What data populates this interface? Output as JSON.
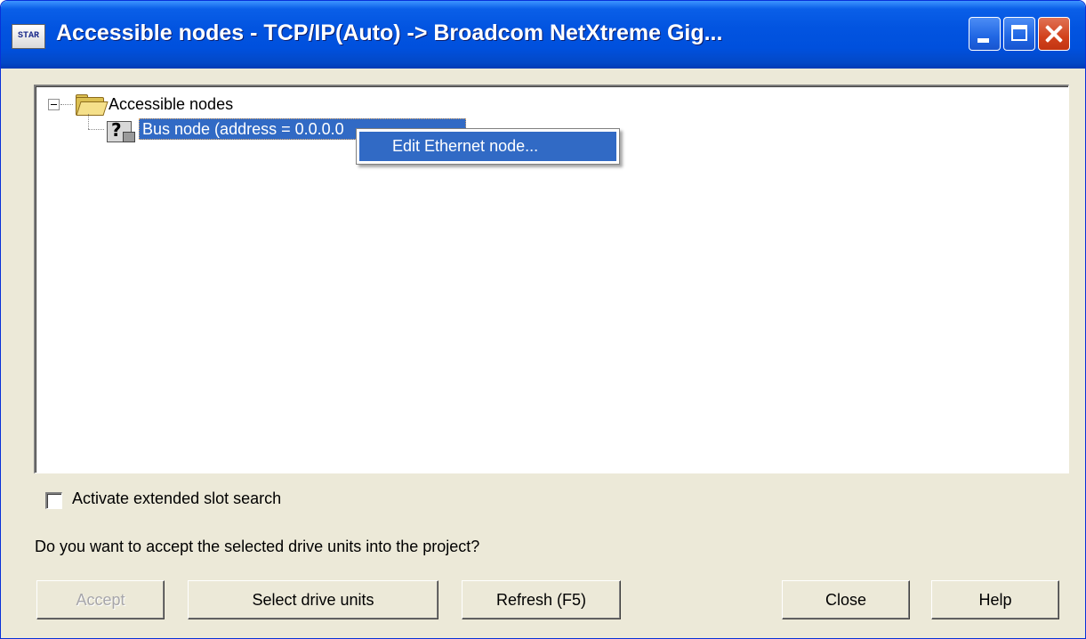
{
  "window": {
    "title": "Accessible nodes - TCP/IP(Auto) -> Broadcom NetXtreme Gig...",
    "icon_text": "STAR",
    "controls": {
      "minimize": "minimize-icon",
      "maximize": "maximize-icon",
      "close": "close-icon"
    }
  },
  "tree": {
    "root": {
      "label": "Accessible nodes",
      "icon": "folder-open-icon",
      "expanded": true
    },
    "children": [
      {
        "label": "Bus node (address = 0.0.0.0",
        "icon": "unknown-device-icon",
        "selected": true
      }
    ]
  },
  "context_menu": {
    "items": [
      {
        "label": "Edit Ethernet node...",
        "highlighted": true
      }
    ]
  },
  "options": {
    "extended_slot_search": {
      "label": "Activate extended slot search",
      "checked": false
    }
  },
  "prompt": "Do you want to accept the selected drive units into the project?",
  "buttons": {
    "accept": "Accept",
    "select_drive_units": "Select drive units",
    "refresh": "Refresh (F5)",
    "close": "Close",
    "help": "Help"
  },
  "colors": {
    "titlebar": "#0054e3",
    "selection": "#316ac5",
    "dialog_background": "#ece9d8"
  }
}
